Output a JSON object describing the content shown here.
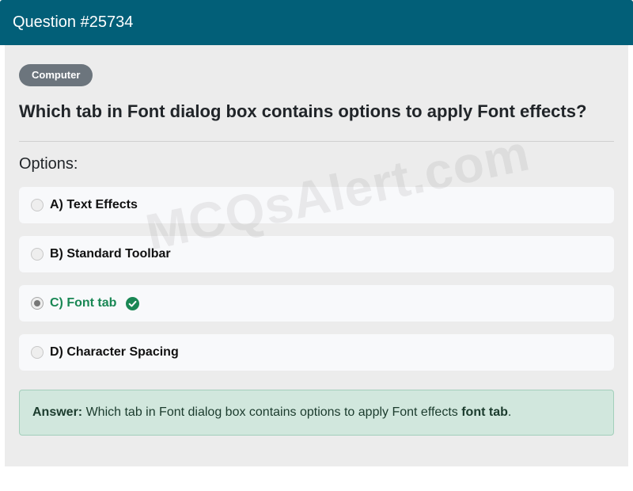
{
  "header": {
    "title": "Question #25734"
  },
  "badge": {
    "label": "Computer"
  },
  "question": {
    "text": "Which tab in Font dialog box contains options to apply Font effects?"
  },
  "options_label": "Options:",
  "options": [
    {
      "label": "A) Text Effects",
      "selected": false,
      "correct": false
    },
    {
      "label": "B) Standard Toolbar",
      "selected": false,
      "correct": false
    },
    {
      "label": "C) Font tab",
      "selected": true,
      "correct": true
    },
    {
      "label": "D) Character Spacing",
      "selected": false,
      "correct": false
    }
  ],
  "answer": {
    "prefix": "Answer:",
    "text": " Which tab in Font dialog box contains options to apply Font effects ",
    "highlight": "font tab",
    "suffix": "."
  },
  "watermark": "MCQsAlert.com",
  "colors": {
    "header_bg": "#025f78",
    "badge_bg": "#6c757d",
    "correct": "#198754",
    "answer_bg": "#d1e7dd"
  },
  "icons": {
    "correct": "check-circle-icon"
  }
}
